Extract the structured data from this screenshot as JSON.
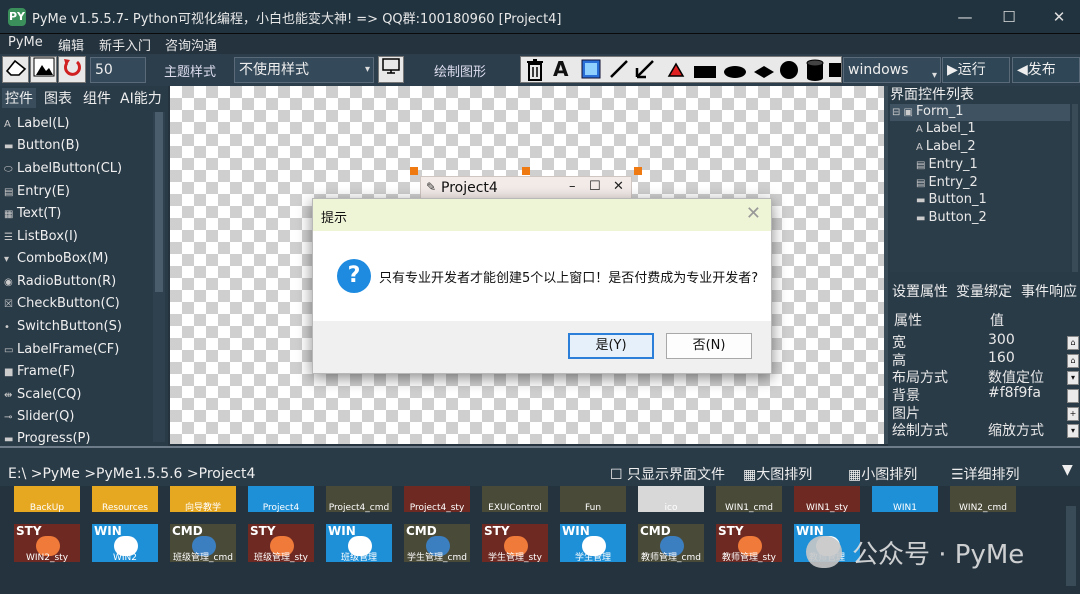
{
  "window": {
    "logo": "PY",
    "title": "PyMe v1.5.5.7- Python可视化编程，小白也能变大神!   => QQ群:100180960    [Project4]",
    "min": "—",
    "max": "☐",
    "close": "✕"
  },
  "menu": [
    "PyMe",
    "编辑",
    "新手入门",
    "咨询沟通"
  ],
  "toolbar": {
    "size_value": "50",
    "theme_label": "主题样式",
    "theme_select": "不使用样式",
    "draw_label": "绘制图形",
    "text_tool": "A",
    "platform_select": "windows",
    "run_label": "▶运行",
    "publish_label": "◀发布"
  },
  "left_tabs": [
    "控件",
    "图表",
    "组件",
    "AI能力"
  ],
  "controls": [
    {
      "icon": "A",
      "label": "Label(L)"
    },
    {
      "icon": "▬",
      "label": "Button(B)"
    },
    {
      "icon": "⬭",
      "label": "LabelButton(CL)"
    },
    {
      "icon": "▤",
      "label": "Entry(E)"
    },
    {
      "icon": "▦",
      "label": "Text(T)"
    },
    {
      "icon": "☰",
      "label": "ListBox(I)"
    },
    {
      "icon": "▾",
      "label": "ComboBox(M)"
    },
    {
      "icon": "◉",
      "label": "RadioButton(R)"
    },
    {
      "icon": "☒",
      "label": "CheckButton(C)"
    },
    {
      "icon": "•",
      "label": "SwitchButton(S)"
    },
    {
      "icon": "▭",
      "label": "LabelFrame(CF)"
    },
    {
      "icon": "■",
      "label": "Frame(F)"
    },
    {
      "icon": "⇹",
      "label": "Scale(CQ)"
    },
    {
      "icon": "⊸",
      "label": "Slider(Q)"
    },
    {
      "icon": "▬",
      "label": "Progress(P)"
    }
  ],
  "form": {
    "title": "Project4",
    "min": "–",
    "max": "☐",
    "close": "✕"
  },
  "right_panel": {
    "title": "界面控件列表",
    "tree": [
      {
        "icon": "⊟ ▣",
        "label": "Form_1",
        "level": 0
      },
      {
        "icon": "A",
        "label": "Label_1",
        "level": 1
      },
      {
        "icon": "A",
        "label": "Label_2",
        "level": 1
      },
      {
        "icon": "▤",
        "label": "Entry_1",
        "level": 1
      },
      {
        "icon": "▤",
        "label": "Entry_2",
        "level": 1
      },
      {
        "icon": "▬",
        "label": "Button_1",
        "level": 1
      },
      {
        "icon": "▬",
        "label": "Button_2",
        "level": 1
      }
    ],
    "tabs": [
      "设置属性",
      "变量绑定",
      "事件响应"
    ],
    "prop_header": {
      "name": "属性",
      "value": "值"
    },
    "props": [
      {
        "name": "宽",
        "value": "300",
        "btn": "⌂"
      },
      {
        "name": "高",
        "value": "160",
        "btn": "⌂"
      },
      {
        "name": "布局方式",
        "value": "数值定位",
        "btn": "▾"
      },
      {
        "name": "背景",
        "value": "#f8f9fa",
        "btn": ""
      },
      {
        "name": "图片",
        "value": "",
        "btn": "+"
      },
      {
        "name": "绘制方式",
        "value": "缩放方式",
        "btn": "▾"
      }
    ]
  },
  "pathbar": {
    "path": "E:\\  >PyMe  >PyMe1.5.5.6  >Project4",
    "only_ui": "☐ 只显示界面文件",
    "large": "▦大图排列",
    "small": "▦小图排列",
    "detail": "☰详细排列",
    "collapse": "▼"
  },
  "files_row1": [
    {
      "label": "BackUp",
      "badge": "",
      "color": "#e6a821"
    },
    {
      "label": "Resources",
      "badge": "",
      "color": "#e6a821"
    },
    {
      "label": "向导教学",
      "badge": "",
      "color": "#e6a821"
    },
    {
      "label": "Project4",
      "badge": "",
      "color": "#1e90d8"
    },
    {
      "label": "Project4_cmd",
      "badge": "",
      "color": "#4a4a38"
    },
    {
      "label": "Project4_sty",
      "badge": "",
      "color": "#6e2a22"
    },
    {
      "label": "EXUIControl",
      "badge": "",
      "color": "#4a4a38"
    },
    {
      "label": "Fun",
      "badge": "",
      "color": "#4a4a38"
    },
    {
      "label": "ico",
      "badge": "",
      "color": "#d8d8d8"
    },
    {
      "label": "WIN1_cmd",
      "badge": "",
      "color": "#4a4a38"
    },
    {
      "label": "WIN1_sty",
      "badge": "",
      "color": "#6e2a22"
    },
    {
      "label": "WIN1",
      "badge": "",
      "color": "#1e90d8"
    },
    {
      "label": "WIN2_cmd",
      "badge": "",
      "color": "#4a4a38"
    }
  ],
  "files_row2": [
    {
      "label": "WIN2_sty",
      "badge": "STY",
      "color": "#6e2a22"
    },
    {
      "label": "WIN2",
      "badge": "WIN",
      "color": "#1e90d8"
    },
    {
      "label": "班级管理_cmd",
      "badge": "CMD",
      "color": "#4a4a38"
    },
    {
      "label": "班级管理_sty",
      "badge": "STY",
      "color": "#6e2a22"
    },
    {
      "label": "班级管理",
      "badge": "WIN",
      "color": "#1e90d8"
    },
    {
      "label": "学生管理_cmd",
      "badge": "CMD",
      "color": "#4a4a38"
    },
    {
      "label": "学生管理_sty",
      "badge": "STY",
      "color": "#6e2a22"
    },
    {
      "label": "学生管理",
      "badge": "WIN",
      "color": "#1e90d8"
    },
    {
      "label": "教师管理_cmd",
      "badge": "CMD",
      "color": "#4a4a38"
    },
    {
      "label": "教师管理_sty",
      "badge": "STY",
      "color": "#6e2a22"
    },
    {
      "label": "教师管理",
      "badge": "WIN",
      "color": "#1e90d8"
    }
  ],
  "watermark": "公众号 · PyMe",
  "dialog": {
    "title": "提示",
    "close": "✕",
    "icon": "?",
    "message": "只有专业开发者才能创建5个以上窗口！是否付费成为专业开发者?",
    "yes": "是(Y)",
    "no": "否(N)"
  }
}
